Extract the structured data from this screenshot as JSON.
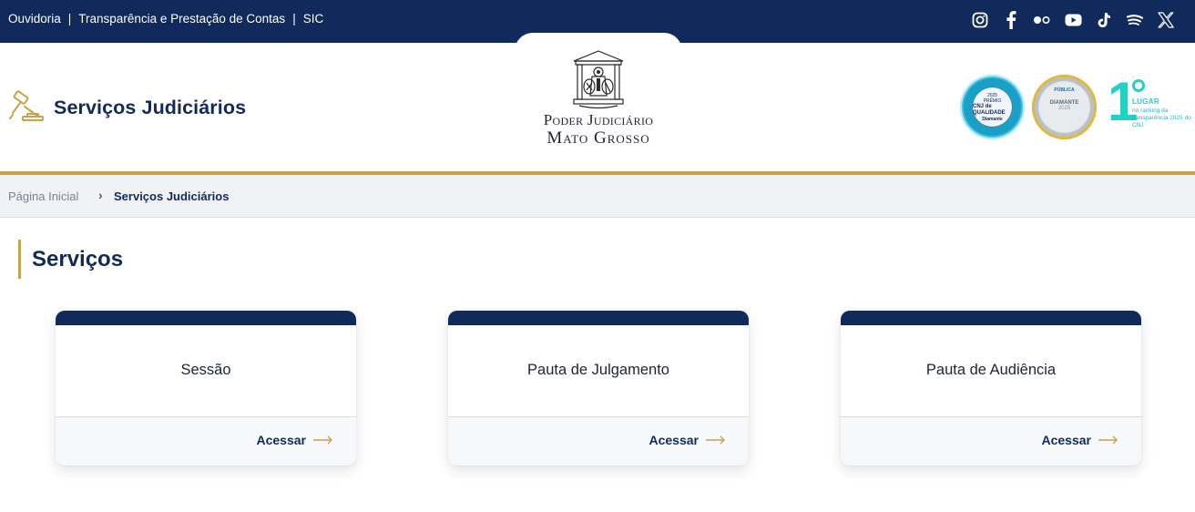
{
  "topbar": {
    "links": [
      "Ouvidoria",
      "Transparência e Prestação de Contas",
      "SIC"
    ],
    "separator": "|",
    "social_icons": [
      "instagram-icon",
      "facebook-icon",
      "flickr-icon",
      "youtube-icon",
      "tiktok-icon",
      "spotify-icon",
      "x-twitter-icon"
    ]
  },
  "header": {
    "brand_title": "Serviços Judiciários",
    "court_line1": "Poder Judiciário",
    "court_line2": "Mato Grosso",
    "badges": {
      "cnj_year": "2025",
      "cnj_line1": "PRÊMIO",
      "cnj_line2": "CNJ de QUALIDADE",
      "cnj_level": "Diamante",
      "transp_top": "PÚBLICA",
      "transp_level": "DIAMANTE",
      "transp_year": "2025"
    },
    "ranking": {
      "position": "1",
      "label": "LUGAR",
      "subtitle": "no ranking da transparência 2025 do CNJ"
    }
  },
  "breadcrumb": {
    "home": "Página Inicial",
    "current": "Serviços Judiciários"
  },
  "main": {
    "section_title": "Serviços",
    "cards": [
      {
        "title": "Sessão",
        "action": "Acessar"
      },
      {
        "title": "Pauta de Julgamento",
        "action": "Acessar"
      },
      {
        "title": "Pauta de Audiência",
        "action": "Acessar"
      }
    ]
  },
  "colors": {
    "navy": "#102a5b",
    "gold": "#c9a24a",
    "teal": "#21d0c6"
  }
}
